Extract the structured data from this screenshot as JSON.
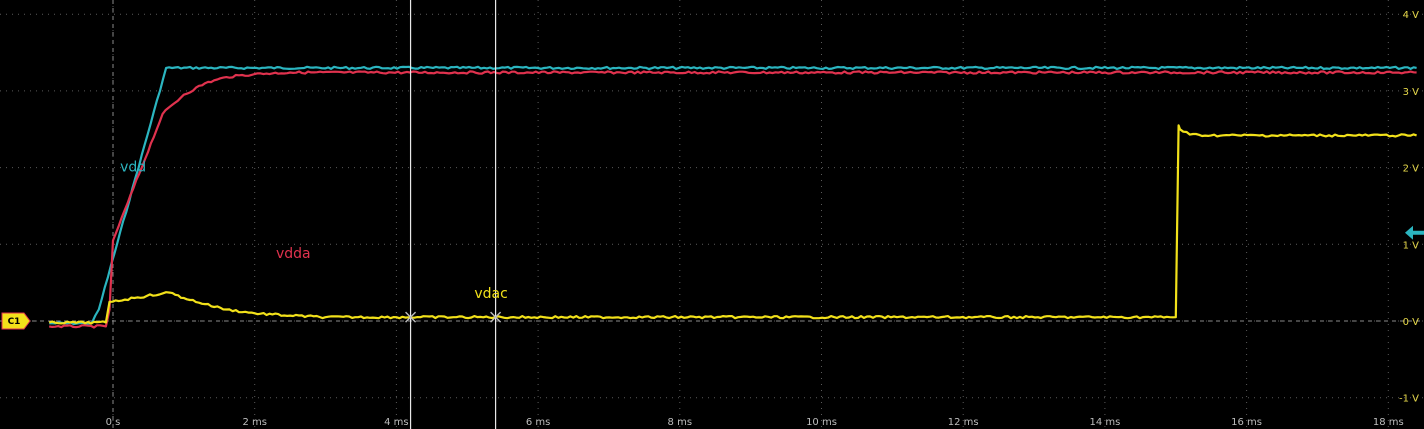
{
  "chart_data": {
    "type": "line",
    "title": "",
    "xlabel": "",
    "ylabel": "",
    "xlim": [
      -0.9,
      18.4
    ],
    "ylim": [
      -1.15,
      4.2
    ],
    "grid": true,
    "x_ticks": [
      {
        "value": 0,
        "label": "0 s"
      },
      {
        "value": 2,
        "label": "2 ms"
      },
      {
        "value": 4,
        "label": "4 ms"
      },
      {
        "value": 6,
        "label": "6 ms"
      },
      {
        "value": 8,
        "label": "8 ms"
      },
      {
        "value": 10,
        "label": "10 ms"
      },
      {
        "value": 12,
        "label": "12 ms"
      },
      {
        "value": 14,
        "label": "14 ms"
      },
      {
        "value": 16,
        "label": "16 ms"
      },
      {
        "value": 18,
        "label": "18 ms"
      }
    ],
    "y_ticks": [
      {
        "value": -1,
        "label": "-1 V"
      },
      {
        "value": 0,
        "label": "0 V"
      },
      {
        "value": 1,
        "label": "1 V"
      },
      {
        "value": 2,
        "label": "2 V"
      },
      {
        "value": 3,
        "label": "3 V"
      },
      {
        "value": 4,
        "label": "4 V"
      }
    ],
    "series": [
      {
        "name": "vdd",
        "color": "#2bb5c0",
        "x": [
          -0.9,
          -0.3,
          -0.2,
          0.75,
          18.4
        ],
        "y": [
          -0.03,
          -0.03,
          0.15,
          3.3,
          3.3
        ]
      },
      {
        "name": "vdda",
        "color": "#e0324e",
        "x": [
          -0.9,
          -0.1,
          -0.05,
          0.0,
          0.7,
          1.0,
          1.3,
          1.6,
          2.0,
          2.5,
          18.4
        ],
        "y": [
          -0.07,
          -0.07,
          0.15,
          1.05,
          2.7,
          2.95,
          3.1,
          3.18,
          3.22,
          3.24,
          3.24
        ]
      },
      {
        "name": "vdac",
        "color": "#f2e11a",
        "x": [
          -0.9,
          -0.1,
          -0.05,
          0.3,
          0.7,
          0.8,
          1.0,
          1.3,
          1.6,
          2.0,
          2.5,
          3.0,
          4.0,
          15.0,
          15.04,
          15.06,
          15.2,
          15.5,
          18.4
        ],
        "y": [
          -0.02,
          -0.02,
          0.25,
          0.3,
          0.36,
          0.37,
          0.3,
          0.22,
          0.15,
          0.1,
          0.07,
          0.05,
          0.05,
          0.05,
          2.55,
          2.5,
          2.43,
          2.42,
          2.42
        ]
      }
    ],
    "cursors": [
      4.2,
      5.4
    ],
    "reference_markers": [
      "C1"
    ],
    "annotations": [
      {
        "text": "vdd",
        "x": 0.1,
        "y": 1.95,
        "color": "#2bb5c0"
      },
      {
        "text": "vdda",
        "x": 2.3,
        "y": 0.82,
        "color": "#e0324e"
      },
      {
        "text": "vdac",
        "x": 5.1,
        "y": 0.3,
        "color": "#f2e11a"
      }
    ]
  }
}
